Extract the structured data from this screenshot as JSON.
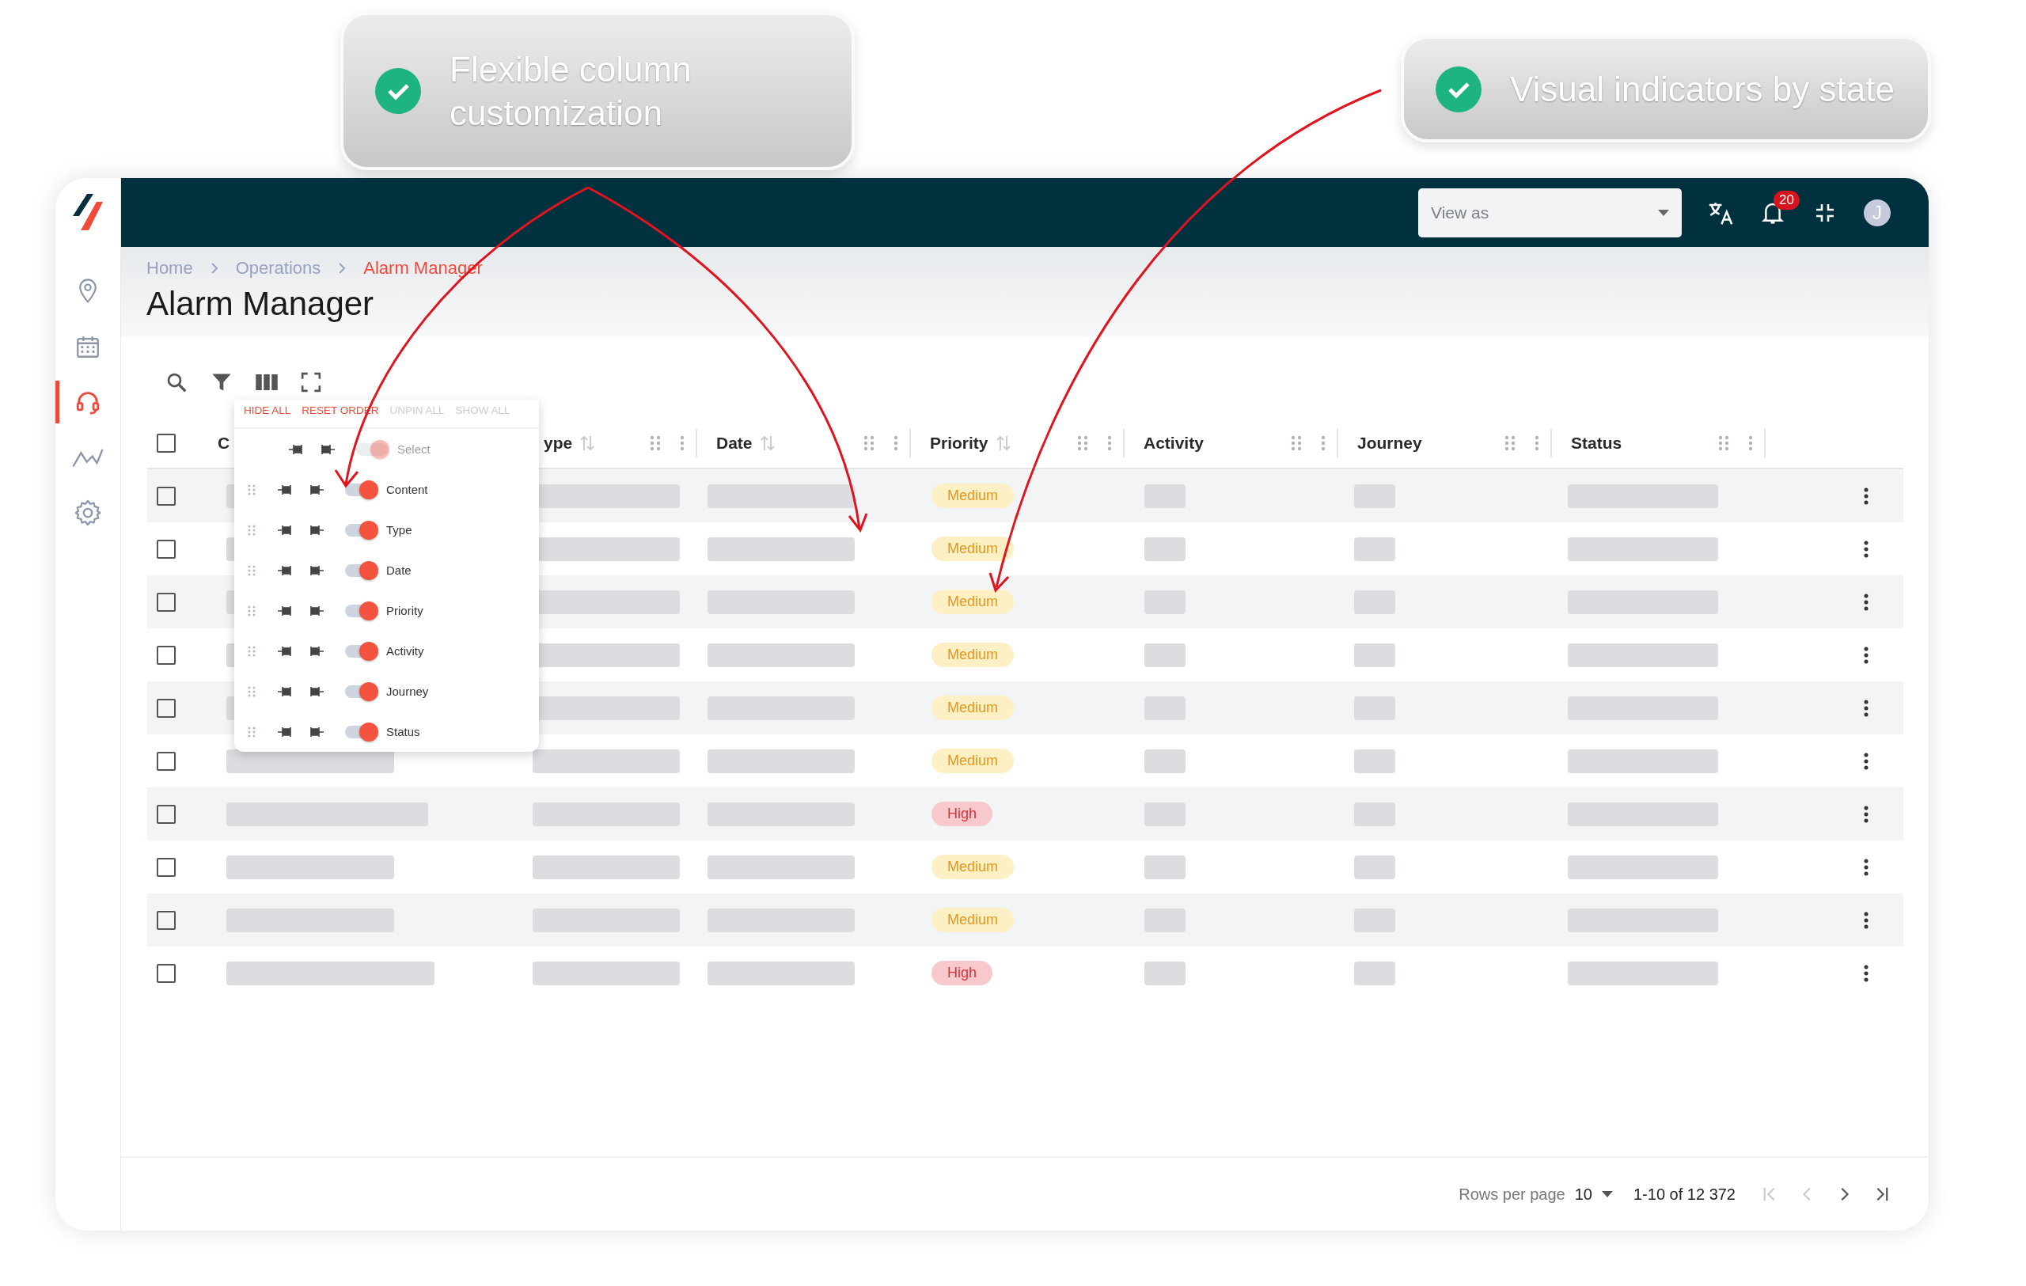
{
  "callouts": [
    {
      "text": "Flexible column customization"
    },
    {
      "text": "Visual indicators by state"
    }
  ],
  "sidebar": {
    "items": [
      {
        "kind": "pin",
        "selected": false
      },
      {
        "kind": "calendar",
        "selected": false
      },
      {
        "kind": "headset",
        "selected": true
      },
      {
        "kind": "chart",
        "selected": false
      },
      {
        "kind": "gear",
        "selected": false
      }
    ]
  },
  "topbar": {
    "view_as": {
      "placeholder": "View as"
    },
    "notifications": {
      "count": "20"
    },
    "avatar": {
      "initial": "J"
    }
  },
  "breadcrumb": [
    {
      "label": "Home",
      "current": false
    },
    {
      "label": "Operations",
      "current": false
    },
    {
      "label": "Alarm Manager",
      "current": true
    }
  ],
  "page_title": "Alarm Manager",
  "toolbar": [
    {
      "kind": "search"
    },
    {
      "kind": "filter"
    },
    {
      "kind": "columns"
    },
    {
      "kind": "fullscreen"
    }
  ],
  "column_menu": {
    "actions": [
      {
        "label": "HIDE ALL",
        "disabled": false
      },
      {
        "label": "RESET ORDER",
        "disabled": false
      },
      {
        "label": "UNPIN ALL",
        "disabled": true
      },
      {
        "label": "SHOW ALL",
        "disabled": true
      }
    ],
    "items": [
      {
        "label": "Select",
        "on": true,
        "disabled": true
      },
      {
        "label": "Content",
        "on": true,
        "disabled": false
      },
      {
        "label": "Type",
        "on": true,
        "disabled": false
      },
      {
        "label": "Date",
        "on": true,
        "disabled": false
      },
      {
        "label": "Priority",
        "on": true,
        "disabled": false
      },
      {
        "label": "Activity",
        "on": true,
        "disabled": false
      },
      {
        "label": "Journey",
        "on": true,
        "disabled": false
      },
      {
        "label": "Status",
        "on": true,
        "disabled": false
      }
    ]
  },
  "table": {
    "select_all": {
      "checked": false
    },
    "columns": [
      {
        "label": "C"
      },
      {
        "label": "ype",
        "sortable": true,
        "menu": true
      },
      {
        "label": "Date",
        "sortable": true,
        "menu": true
      },
      {
        "label": "Priority",
        "sortable": true,
        "menu": true
      },
      {
        "label": "Activity",
        "sortable": false,
        "menu": true
      },
      {
        "label": "Journey",
        "sortable": false,
        "menu": true
      },
      {
        "label": "Status",
        "sortable": false,
        "menu": true
      }
    ],
    "rows": [
      {
        "checked": false,
        "priority": {
          "label": "Medium",
          "kind": "medium"
        }
      },
      {
        "checked": false,
        "priority": {
          "label": "Medium",
          "kind": "medium"
        }
      },
      {
        "checked": false,
        "priority": {
          "label": "Medium",
          "kind": "medium"
        }
      },
      {
        "checked": false,
        "priority": {
          "label": "Medium",
          "kind": "medium"
        }
      },
      {
        "checked": false,
        "priority": {
          "label": "Medium",
          "kind": "medium"
        }
      },
      {
        "checked": false,
        "priority": {
          "label": "Medium",
          "kind": "medium"
        }
      },
      {
        "checked": false,
        "priority": {
          "label": "High",
          "kind": "high"
        }
      },
      {
        "checked": false,
        "priority": {
          "label": "Medium",
          "kind": "medium"
        }
      },
      {
        "checked": false,
        "priority": {
          "label": "Medium",
          "kind": "medium"
        }
      },
      {
        "checked": false,
        "priority": {
          "label": "High",
          "kind": "high"
        }
      }
    ]
  },
  "pagination": {
    "rows_per_page_label": "Rows per page",
    "rows_per_page": "10",
    "range": "1-10 of 12 372",
    "buttons": [
      {
        "kind": "first",
        "disabled": true
      },
      {
        "kind": "prev",
        "disabled": true
      },
      {
        "kind": "next",
        "disabled": false
      },
      {
        "kind": "last",
        "disabled": false
      }
    ]
  }
}
